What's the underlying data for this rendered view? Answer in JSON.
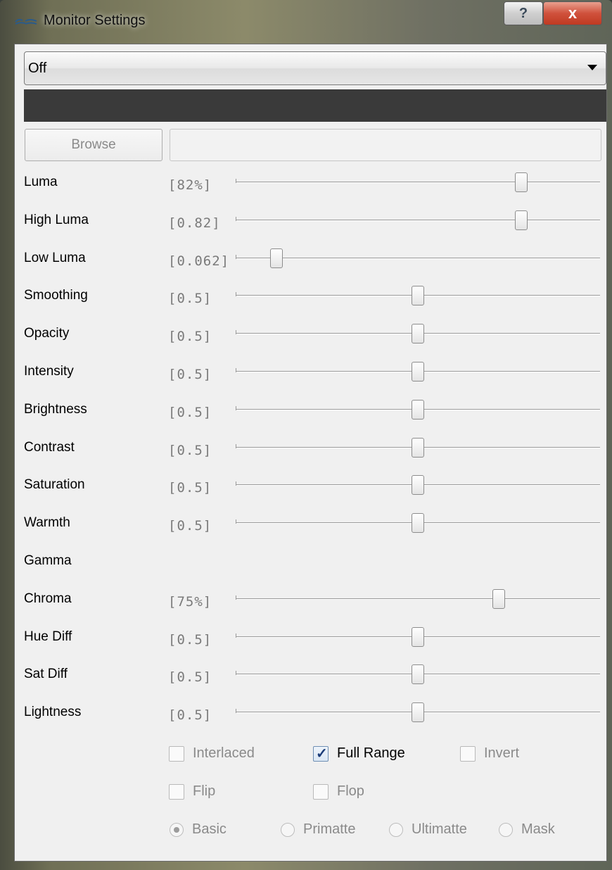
{
  "window": {
    "title": "Monitor Settings",
    "help_label": "?",
    "close_label": "x"
  },
  "mode_select": {
    "value": "Off"
  },
  "browse": {
    "label": "Browse",
    "path_value": ""
  },
  "sliders": [
    {
      "label": "Luma",
      "value_text": "[82%]",
      "value": 0.82
    },
    {
      "label": "High Luma",
      "value_text": "[0.82]",
      "value": 0.82
    },
    {
      "label": "Low Luma",
      "value_text": "[0.062]",
      "value": 0.062
    },
    {
      "label": "Smoothing",
      "value_text": "[0.5]",
      "value": 0.5
    },
    {
      "label": "Opacity",
      "value_text": "[0.5]",
      "value": 0.5
    },
    {
      "label": "Intensity",
      "value_text": "[0.5]",
      "value": 0.5
    },
    {
      "label": "Brightness",
      "value_text": "[0.5]",
      "value": 0.5
    },
    {
      "label": "Contrast",
      "value_text": "[0.5]",
      "value": 0.5
    },
    {
      "label": "Saturation",
      "value_text": "[0.5]",
      "value": 0.5
    },
    {
      "label": "Warmth",
      "value_text": "[0.5]",
      "value": 0.5
    },
    {
      "label": "Gamma",
      "value_text": "",
      "value": null
    },
    {
      "label": "Chroma",
      "value_text": "[75%]",
      "value": 0.75
    },
    {
      "label": "Hue Diff",
      "value_text": "[0.5]",
      "value": 0.5
    },
    {
      "label": "Sat Diff",
      "value_text": "[0.5]",
      "value": 0.5
    },
    {
      "label": "Lightness",
      "value_text": "[0.5]",
      "value": 0.5
    }
  ],
  "checkboxes": {
    "interlaced": {
      "label": "Interlaced",
      "checked": false
    },
    "full_range": {
      "label": "Full Range",
      "checked": true
    },
    "invert": {
      "label": "Invert",
      "checked": false
    },
    "flip": {
      "label": "Flip",
      "checked": false
    },
    "flop": {
      "label": "Flop",
      "checked": false
    }
  },
  "radios": {
    "basic": {
      "label": "Basic",
      "selected": true
    },
    "primatte": {
      "label": "Primatte",
      "selected": false
    },
    "ultimatte": {
      "label": "Ultimatte",
      "selected": false
    },
    "mask": {
      "label": "Mask",
      "selected": false
    }
  }
}
